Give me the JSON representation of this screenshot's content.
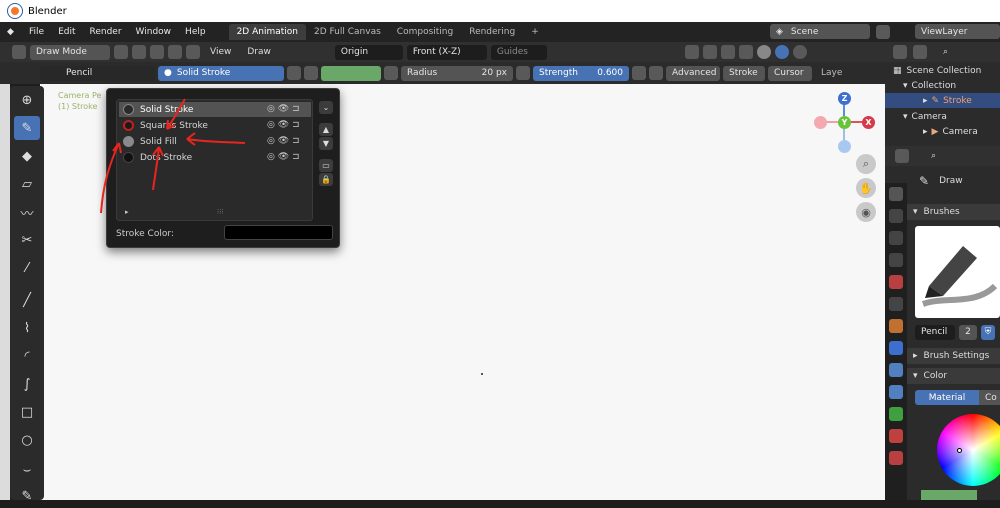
{
  "window": {
    "title": "Blender"
  },
  "menu": {
    "items": [
      "File",
      "Edit",
      "Render",
      "Window",
      "Help"
    ]
  },
  "workspaces": [
    "2D Animation",
    "2D Full Canvas",
    "Compositing",
    "Rendering"
  ],
  "workspace_add": "+",
  "scene": {
    "name": "Scene",
    "view_layer": "ViewLayer"
  },
  "header": {
    "mode": "Draw Mode",
    "view": "View",
    "draw": "Draw",
    "origin": "Origin",
    "projection": "Front (X-Z)",
    "guides": "Guides"
  },
  "tool_settings": {
    "brush": "Pencil",
    "material": "Solid Stroke",
    "radius_label": "Radius",
    "radius_value": "20 px",
    "strength_label": "Strength",
    "strength_value": "0.600",
    "advanced": "Advanced",
    "stroke": "Stroke",
    "cursor": "Cursor",
    "layer": "Laye"
  },
  "viewport": {
    "camera_label": "Camera Pe",
    "object_label": "(1) Stroke"
  },
  "material_popup": {
    "materials": [
      {
        "name": "Solid Stroke",
        "color": "#2a2a2a"
      },
      {
        "name": "Squares Stroke",
        "color": "#c02020"
      },
      {
        "name": "Solid Fill",
        "color": "#8a8a8a"
      },
      {
        "name": "Dots Stroke",
        "color": "#111111"
      }
    ],
    "stroke_color_label": "Stroke Color:",
    "stroke_color_value": "#000000"
  },
  "outliner": {
    "scene_collection": "Scene Collection",
    "collection": "Collection",
    "stroke": "Stroke",
    "camera_group": "Camera",
    "camera_obj": "Camera"
  },
  "properties": {
    "tool": "Draw",
    "brushes_header": "Brushes",
    "brush_name": "Pencil",
    "brush_users": "2",
    "brush_settings": "Brush Settings",
    "color": "Color",
    "material_tab": "Material",
    "color_tab_partial": "Co"
  },
  "gizmo": {
    "x": "X",
    "y": "Y",
    "z": "Z"
  },
  "colors": {
    "accent": "#4772b3",
    "annotation_arrows": "#e8251f"
  }
}
